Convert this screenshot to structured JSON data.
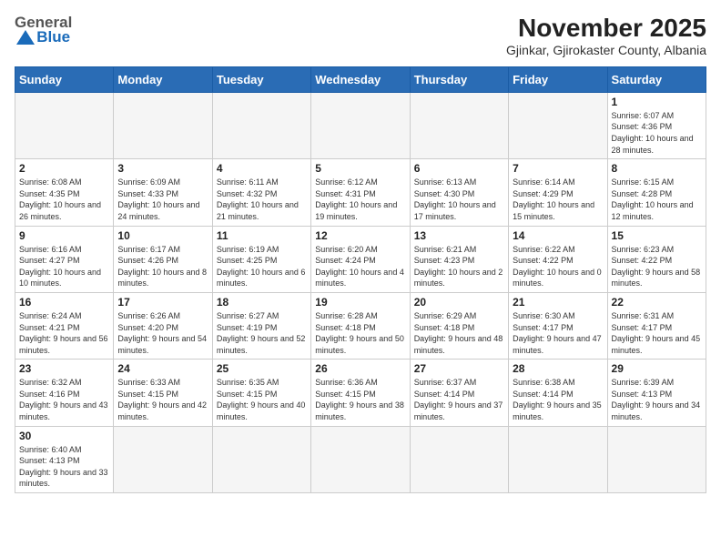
{
  "header": {
    "logo_general": "General",
    "logo_blue": "Blue",
    "title": "November 2025",
    "subtitle": "Gjinkar, Gjirokaster County, Albania"
  },
  "weekdays": [
    "Sunday",
    "Monday",
    "Tuesday",
    "Wednesday",
    "Thursday",
    "Friday",
    "Saturday"
  ],
  "weeks": [
    [
      {
        "day": "",
        "info": ""
      },
      {
        "day": "",
        "info": ""
      },
      {
        "day": "",
        "info": ""
      },
      {
        "day": "",
        "info": ""
      },
      {
        "day": "",
        "info": ""
      },
      {
        "day": "",
        "info": ""
      },
      {
        "day": "1",
        "info": "Sunrise: 6:07 AM\nSunset: 4:36 PM\nDaylight: 10 hours and 28 minutes."
      }
    ],
    [
      {
        "day": "2",
        "info": "Sunrise: 6:08 AM\nSunset: 4:35 PM\nDaylight: 10 hours and 26 minutes."
      },
      {
        "day": "3",
        "info": "Sunrise: 6:09 AM\nSunset: 4:33 PM\nDaylight: 10 hours and 24 minutes."
      },
      {
        "day": "4",
        "info": "Sunrise: 6:11 AM\nSunset: 4:32 PM\nDaylight: 10 hours and 21 minutes."
      },
      {
        "day": "5",
        "info": "Sunrise: 6:12 AM\nSunset: 4:31 PM\nDaylight: 10 hours and 19 minutes."
      },
      {
        "day": "6",
        "info": "Sunrise: 6:13 AM\nSunset: 4:30 PM\nDaylight: 10 hours and 17 minutes."
      },
      {
        "day": "7",
        "info": "Sunrise: 6:14 AM\nSunset: 4:29 PM\nDaylight: 10 hours and 15 minutes."
      },
      {
        "day": "8",
        "info": "Sunrise: 6:15 AM\nSunset: 4:28 PM\nDaylight: 10 hours and 12 minutes."
      }
    ],
    [
      {
        "day": "9",
        "info": "Sunrise: 6:16 AM\nSunset: 4:27 PM\nDaylight: 10 hours and 10 minutes."
      },
      {
        "day": "10",
        "info": "Sunrise: 6:17 AM\nSunset: 4:26 PM\nDaylight: 10 hours and 8 minutes."
      },
      {
        "day": "11",
        "info": "Sunrise: 6:19 AM\nSunset: 4:25 PM\nDaylight: 10 hours and 6 minutes."
      },
      {
        "day": "12",
        "info": "Sunrise: 6:20 AM\nSunset: 4:24 PM\nDaylight: 10 hours and 4 minutes."
      },
      {
        "day": "13",
        "info": "Sunrise: 6:21 AM\nSunset: 4:23 PM\nDaylight: 10 hours and 2 minutes."
      },
      {
        "day": "14",
        "info": "Sunrise: 6:22 AM\nSunset: 4:22 PM\nDaylight: 10 hours and 0 minutes."
      },
      {
        "day": "15",
        "info": "Sunrise: 6:23 AM\nSunset: 4:22 PM\nDaylight: 9 hours and 58 minutes."
      }
    ],
    [
      {
        "day": "16",
        "info": "Sunrise: 6:24 AM\nSunset: 4:21 PM\nDaylight: 9 hours and 56 minutes."
      },
      {
        "day": "17",
        "info": "Sunrise: 6:26 AM\nSunset: 4:20 PM\nDaylight: 9 hours and 54 minutes."
      },
      {
        "day": "18",
        "info": "Sunrise: 6:27 AM\nSunset: 4:19 PM\nDaylight: 9 hours and 52 minutes."
      },
      {
        "day": "19",
        "info": "Sunrise: 6:28 AM\nSunset: 4:18 PM\nDaylight: 9 hours and 50 minutes."
      },
      {
        "day": "20",
        "info": "Sunrise: 6:29 AM\nSunset: 4:18 PM\nDaylight: 9 hours and 48 minutes."
      },
      {
        "day": "21",
        "info": "Sunrise: 6:30 AM\nSunset: 4:17 PM\nDaylight: 9 hours and 47 minutes."
      },
      {
        "day": "22",
        "info": "Sunrise: 6:31 AM\nSunset: 4:17 PM\nDaylight: 9 hours and 45 minutes."
      }
    ],
    [
      {
        "day": "23",
        "info": "Sunrise: 6:32 AM\nSunset: 4:16 PM\nDaylight: 9 hours and 43 minutes."
      },
      {
        "day": "24",
        "info": "Sunrise: 6:33 AM\nSunset: 4:15 PM\nDaylight: 9 hours and 42 minutes."
      },
      {
        "day": "25",
        "info": "Sunrise: 6:35 AM\nSunset: 4:15 PM\nDaylight: 9 hours and 40 minutes."
      },
      {
        "day": "26",
        "info": "Sunrise: 6:36 AM\nSunset: 4:15 PM\nDaylight: 9 hours and 38 minutes."
      },
      {
        "day": "27",
        "info": "Sunrise: 6:37 AM\nSunset: 4:14 PM\nDaylight: 9 hours and 37 minutes."
      },
      {
        "day": "28",
        "info": "Sunrise: 6:38 AM\nSunset: 4:14 PM\nDaylight: 9 hours and 35 minutes."
      },
      {
        "day": "29",
        "info": "Sunrise: 6:39 AM\nSunset: 4:13 PM\nDaylight: 9 hours and 34 minutes."
      }
    ],
    [
      {
        "day": "30",
        "info": "Sunrise: 6:40 AM\nSunset: 4:13 PM\nDaylight: 9 hours and 33 minutes."
      },
      {
        "day": "",
        "info": ""
      },
      {
        "day": "",
        "info": ""
      },
      {
        "day": "",
        "info": ""
      },
      {
        "day": "",
        "info": ""
      },
      {
        "day": "",
        "info": ""
      },
      {
        "day": "",
        "info": ""
      }
    ]
  ]
}
